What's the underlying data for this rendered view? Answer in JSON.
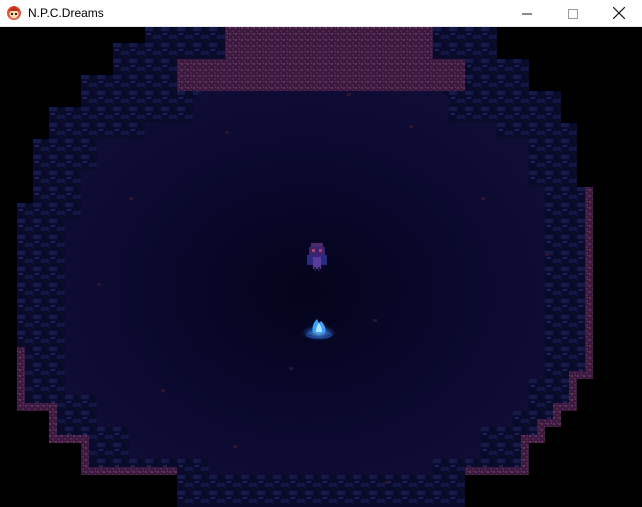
{
  "window": {
    "title": "N.P.C.Dreams",
    "app_icon": "npc-face-icon",
    "controls": {
      "minimize_icon": "minimize-icon",
      "maximize_icon": "maximize-icon",
      "close_icon": "close-icon"
    }
  },
  "scene": {
    "type": "dark-cave-room",
    "player_character": "npc-player-sprite",
    "object": "blue-flame-spirit",
    "colors": {
      "floor": "#0d0a2e",
      "floor_dark": "#06051a",
      "rock_edge": "#5a2a55",
      "rock_top": "#3b1b3d",
      "rim_blue": "#1f2466",
      "flame": "#3da0ff"
    }
  }
}
